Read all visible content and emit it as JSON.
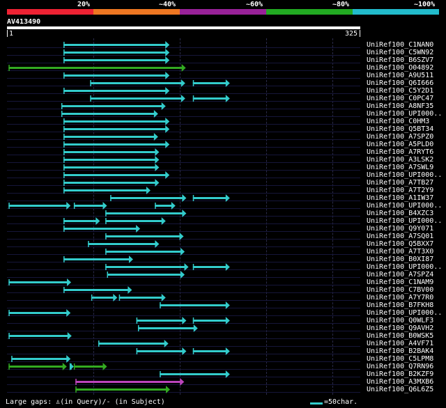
{
  "header": {
    "percent_labels": [
      "20%",
      "~40%",
      "~60%",
      "~80%",
      "~100%"
    ],
    "band_colors": [
      "#ee2233",
      "#ee7722",
      "#992299",
      "#22aa22",
      "#22bbcc"
    ]
  },
  "query": {
    "name": "AV413490",
    "start_label": "1",
    "end_label": "325",
    "length": 325
  },
  "colors": {
    "cyan": "#33cccc",
    "green": "#33aa22",
    "magenta": "#bb44bb"
  },
  "hits": [
    {
      "label": "UniRef100_C1NAN0",
      "segments": [
        {
          "start": 104,
          "end": 299,
          "color": "cyan"
        }
      ]
    },
    {
      "label": "UniRef100_C5WN92",
      "segments": [
        {
          "start": 104,
          "end": 299,
          "color": "cyan"
        }
      ]
    },
    {
      "label": "UniRef100_B6SZV7",
      "segments": [
        {
          "start": 104,
          "end": 299,
          "color": "cyan"
        }
      ]
    },
    {
      "label": "UniRef100_O04892",
      "segments": [
        {
          "start": 3,
          "end": 329,
          "color": "green"
        }
      ]
    },
    {
      "label": "UniRef100_A9U511",
      "segments": [
        {
          "start": 104,
          "end": 299,
          "color": "cyan"
        }
      ]
    },
    {
      "label": "UniRef100_Q6I666",
      "segments": [
        {
          "start": 153,
          "end": 328,
          "color": "cyan"
        },
        {
          "start": 342,
          "end": 410,
          "color": "cyan"
        }
      ]
    },
    {
      "label": "UniRef100_C5Y2D1",
      "segments": [
        {
          "start": 104,
          "end": 299,
          "color": "cyan"
        }
      ]
    },
    {
      "label": "UniRef100_C0PC47",
      "segments": [
        {
          "start": 153,
          "end": 328,
          "color": "cyan"
        },
        {
          "start": 342,
          "end": 410,
          "color": "cyan"
        }
      ]
    },
    {
      "label": "UniRef100_A8NF35",
      "segments": [
        {
          "start": 100,
          "end": 292,
          "color": "cyan"
        }
      ]
    },
    {
      "label": "UniRef100_UPI000..",
      "segments": [
        {
          "start": 100,
          "end": 278,
          "color": "cyan"
        }
      ]
    },
    {
      "label": "UniRef100_C0HM3",
      "segments": [
        {
          "start": 104,
          "end": 299,
          "color": "cyan"
        }
      ]
    },
    {
      "label": "UniRef100_Q5BT34",
      "segments": [
        {
          "start": 104,
          "end": 299,
          "color": "cyan"
        }
      ]
    },
    {
      "label": "UniRef100_A7SPZ0",
      "segments": [
        {
          "start": 104,
          "end": 278,
          "color": "cyan"
        }
      ]
    },
    {
      "label": "UniRef100_A5PLD0",
      "segments": [
        {
          "start": 104,
          "end": 299,
          "color": "cyan"
        }
      ]
    },
    {
      "label": "UniRef100_A7RYT6",
      "segments": [
        {
          "start": 104,
          "end": 280,
          "color": "cyan"
        }
      ]
    },
    {
      "label": "UniRef100_A3LSK2",
      "segments": [
        {
          "start": 104,
          "end": 280,
          "color": "cyan"
        }
      ]
    },
    {
      "label": "UniRef100_A7SWL9",
      "segments": [
        {
          "start": 104,
          "end": 280,
          "color": "cyan"
        }
      ]
    },
    {
      "label": "UniRef100_UPI000..",
      "segments": [
        {
          "start": 104,
          "end": 299,
          "color": "cyan"
        }
      ]
    },
    {
      "label": "UniRef100_A7TB27",
      "segments": [
        {
          "start": 104,
          "end": 280,
          "color": "cyan"
        }
      ]
    },
    {
      "label": "UniRef100_A7T2Y9",
      "segments": [
        {
          "start": 104,
          "end": 264,
          "color": "cyan"
        }
      ]
    },
    {
      "label": "UniRef100_A1IW37",
      "segments": [
        {
          "start": 190,
          "end": 330,
          "color": "cyan"
        },
        {
          "start": 342,
          "end": 410,
          "color": "cyan"
        }
      ]
    },
    {
      "label": "UniRef100_UPI000..",
      "segments": [
        {
          "start": 3,
          "end": 117,
          "color": "cyan"
        },
        {
          "start": 123,
          "end": 184,
          "color": "cyan"
        },
        {
          "start": 272,
          "end": 310,
          "color": "cyan"
        }
      ]
    },
    {
      "label": "UniRef100_B4XZC3",
      "segments": [
        {
          "start": 181,
          "end": 330,
          "color": "cyan"
        }
      ]
    },
    {
      "label": "UniRef100_UPI000..",
      "segments": [
        {
          "start": 104,
          "end": 171,
          "color": "cyan"
        },
        {
          "start": 181,
          "end": 292,
          "color": "cyan"
        }
      ]
    },
    {
      "label": "UniRef100_Q9Y071",
      "segments": [
        {
          "start": 104,
          "end": 245,
          "color": "cyan"
        }
      ]
    },
    {
      "label": "UniRef100_A7SQ01",
      "segments": [
        {
          "start": 181,
          "end": 325,
          "color": "cyan"
        }
      ]
    },
    {
      "label": "UniRef100_Q5BXX7",
      "segments": [
        {
          "start": 149,
          "end": 280,
          "color": "cyan"
        }
      ]
    },
    {
      "label": "UniRef100_A7T3X0",
      "segments": [
        {
          "start": 181,
          "end": 327,
          "color": "cyan"
        }
      ]
    },
    {
      "label": "UniRef100_B0XI87",
      "segments": [
        {
          "start": 104,
          "end": 232,
          "color": "cyan"
        }
      ]
    },
    {
      "label": "UniRef100_UPI000..",
      "segments": [
        {
          "start": 181,
          "end": 334,
          "color": "cyan"
        },
        {
          "start": 342,
          "end": 410,
          "color": "cyan"
        }
      ]
    },
    {
      "label": "UniRef100_A7SPZ4",
      "segments": [
        {
          "start": 184,
          "end": 327,
          "color": "cyan"
        }
      ]
    },
    {
      "label": "UniRef100_C1NAM9",
      "segments": [
        {
          "start": 3,
          "end": 118,
          "color": "cyan"
        }
      ]
    },
    {
      "label": "UniRef100_C7BV00",
      "segments": [
        {
          "start": 104,
          "end": 230,
          "color": "cyan"
        }
      ]
    },
    {
      "label": "UniRef100_A7Y7R0",
      "segments": [
        {
          "start": 155,
          "end": 203,
          "color": "cyan"
        },
        {
          "start": 206,
          "end": 292,
          "color": "cyan"
        }
      ]
    },
    {
      "label": "UniRef100_B7FKH8",
      "segments": [
        {
          "start": 281,
          "end": 410,
          "color": "cyan"
        }
      ]
    },
    {
      "label": "UniRef100_UPI000..",
      "segments": [
        {
          "start": 3,
          "end": 117,
          "color": "cyan"
        }
      ]
    },
    {
      "label": "UniRef100_Q0WLF3",
      "segments": [
        {
          "start": 238,
          "end": 330,
          "color": "cyan"
        },
        {
          "start": 342,
          "end": 410,
          "color": "cyan"
        }
      ]
    },
    {
      "label": "UniRef100_Q9AVH2",
      "segments": [
        {
          "start": 241,
          "end": 351,
          "color": "cyan"
        }
      ]
    },
    {
      "label": "UniRef100_B0WSK5",
      "segments": [
        {
          "start": 3,
          "end": 119,
          "color": "cyan"
        }
      ]
    },
    {
      "label": "UniRef100_A4VF71",
      "segments": [
        {
          "start": 168,
          "end": 297,
          "color": "cyan"
        }
      ]
    },
    {
      "label": "UniRef100_B2BAK4",
      "segments": [
        {
          "start": 238,
          "end": 330,
          "color": "cyan"
        },
        {
          "start": 342,
          "end": 410,
          "color": "cyan"
        }
      ]
    },
    {
      "label": "UniRef100_C5LPM8",
      "segments": [
        {
          "start": 8,
          "end": 117,
          "color": "cyan"
        }
      ]
    },
    {
      "label": "UniRef100_Q7RN96",
      "segments": [
        {
          "start": 3,
          "end": 110,
          "color": "green"
        },
        {
          "start": 117,
          "end": 123,
          "color": "cyan"
        },
        {
          "start": 123,
          "end": 184,
          "color": "green"
        }
      ]
    },
    {
      "label": "UniRef100_B2KZF9",
      "segments": [
        {
          "start": 281,
          "end": 410,
          "color": "cyan"
        }
      ]
    },
    {
      "label": "UniRef100_A3MXB6",
      "segments": [
        {
          "start": 126,
          "end": 326,
          "color": "magenta"
        }
      ]
    },
    {
      "label": "UniRef100_Q6L6Z5",
      "segments": [
        {
          "start": 126,
          "end": 300,
          "color": "green"
        }
      ]
    }
  ],
  "footer": {
    "gaps_text": "Large gaps: ♙(in Query)/- (in Subject)",
    "legend_text": "=50char."
  }
}
